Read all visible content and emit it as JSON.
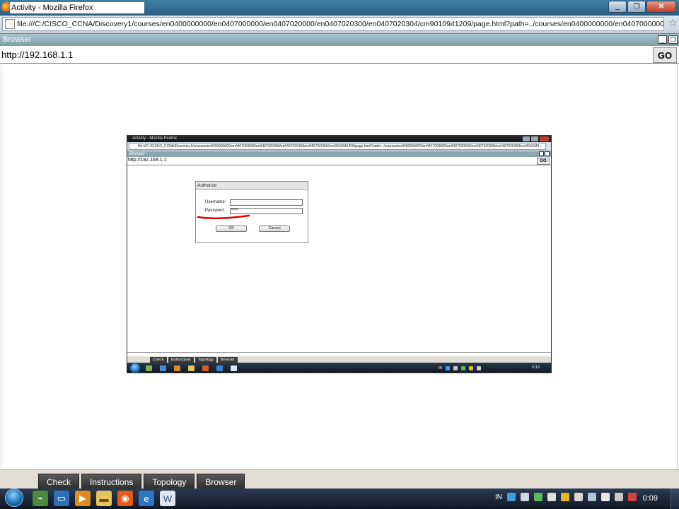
{
  "window": {
    "title": "Activity - Mozilla Firefox",
    "url": "file:///C:/CISCO_CCNA/Discovery1/courses/en0400000000/en0407000000/en0407020000/en0407020300/en0407020304/cm9010941209/page.html?path=../courses/en0400000000/en0407000000/en0407020000/en0407020300/en0407020304/cm9010941...",
    "minimize": "_",
    "restore": "❐",
    "close": "✕",
    "star": "☆"
  },
  "browser": {
    "title": "Browser",
    "address": "http://192.168.1.1",
    "go_label": "GO"
  },
  "bottom_tabs": [
    "Check",
    "Instructions",
    "Topology",
    "Browser"
  ],
  "taskbar": {
    "pinned_icons": [
      "packet-tracer-icon",
      "monitor-icon",
      "media-player-icon",
      "folder-icon",
      "firefox-icon",
      "ie-icon",
      "word-icon"
    ],
    "tray_lang": "IN",
    "clock": "0:09"
  },
  "inner": {
    "title": "Activity - Mozilla Firefox",
    "url": "file:///C:/CISCO_CCNA/Discovery1/courses/en0400000000/en0407000000/en0407020000/en0407020300/en0407020304/cm9010941209/page.html?path=../courses/en0400000000/en0407000000/en0407020000/en0407020300/en0407020304/cm9010941...",
    "browser_title": "Browser",
    "address": "http://192.168.1.1",
    "go_label": "GO",
    "auth": {
      "header": "Authorize",
      "username_label": "Username:",
      "username_value": "",
      "password_label": "Password:",
      "password_value": "*****",
      "ok_label": "OK",
      "cancel_label": "Cancel"
    },
    "bottom_tabs": [
      "Check",
      "Instructions",
      "Topology",
      "Browser"
    ],
    "tray_lang": "IN",
    "clock": "0:13"
  },
  "colors": {
    "titlebar": "#2a5f82",
    "pt_bar": "#7f9da9",
    "taskbar": "#0f1724",
    "red_annotation": "#e00000"
  }
}
